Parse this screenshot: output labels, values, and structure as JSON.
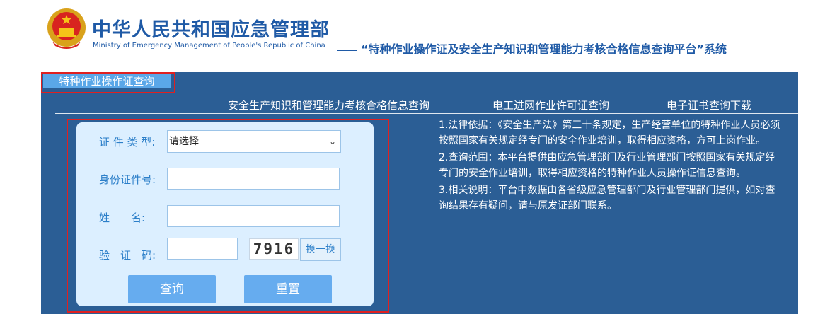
{
  "header": {
    "org_name_cn": "中华人民共和国应急管理部",
    "org_name_en": "Ministry of Emergency Management of People's Republic of China",
    "platform_title": "“特种作业操作证及安全生产知识和管理能力考核合格信息查询平台”系统"
  },
  "tabs": [
    {
      "label": "特种作业操作证查询",
      "active": true
    },
    {
      "label": "安全生产知识和管理能力考核合格信息查询",
      "active": false
    },
    {
      "label": "电工进网作业许可证查询",
      "active": false
    },
    {
      "label": "电子证书查询下载",
      "active": false
    }
  ],
  "form": {
    "cert_type_label": "证 件 类 型:",
    "cert_type_value": "请选择",
    "id_label": "身份证件号:",
    "id_value": "",
    "name_label": "姓　　名:",
    "name_value": "",
    "captcha_label": "验　证　码:",
    "captcha_value": "",
    "captcha_text": "7916",
    "refresh_label": "换一换",
    "search_label": "查询",
    "reset_label": "重置"
  },
  "info": {
    "p1": "1.法律依据：《安全生产法》第三十条规定，生产经营单位的特种作业人员必须按照国家有关规定经专门的安全作业培训，取得相应资格，方可上岗作业。",
    "p2": "2.查询范围：本平台提供由应急管理部门及行业管理部门按照国家有关规定经专门的安全作业培训，取得相应资格的特种作业人员操作证信息查询。",
    "p3": "3.相关说明：平台中数据由各省级应急管理部门及行业管理部门提供，如对查询结果存有疑问，请与原发证部门联系。"
  },
  "colors": {
    "brand": "#1f5aa6",
    "panel": "#2b5e95",
    "highlight": "#e02020",
    "button": "#66acef"
  }
}
